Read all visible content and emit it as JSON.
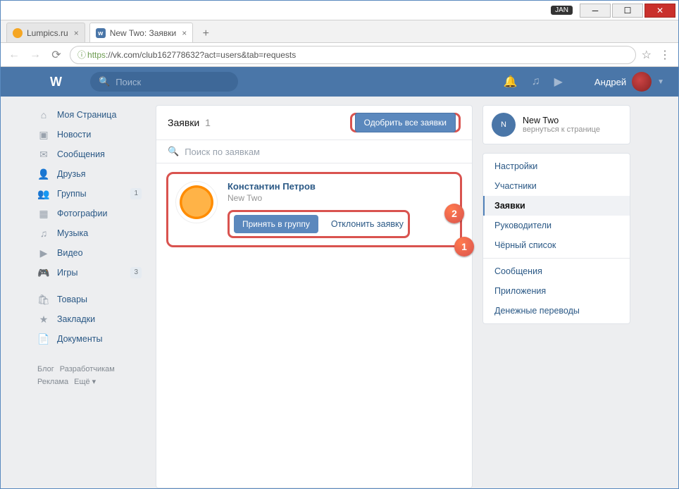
{
  "browser": {
    "ext_label": "JAN",
    "tabs": [
      {
        "title": "Lumpics.ru",
        "favicon": "lumpics"
      },
      {
        "title": "New Two: Заявки",
        "favicon": "vk"
      }
    ],
    "url_proto": "https",
    "url_rest": "://vk.com/club162778632?act=users&tab=requests"
  },
  "vk_header": {
    "search_placeholder": "Поиск",
    "username": "Андрей"
  },
  "sidebar": {
    "items": [
      {
        "icon": "⌂",
        "label": "Моя Страница",
        "badge": ""
      },
      {
        "icon": "▣",
        "label": "Новости",
        "badge": ""
      },
      {
        "icon": "✉",
        "label": "Сообщения",
        "badge": ""
      },
      {
        "icon": "👤",
        "label": "Друзья",
        "badge": ""
      },
      {
        "icon": "👥",
        "label": "Группы",
        "badge": "1"
      },
      {
        "icon": "▦",
        "label": "Фотографии",
        "badge": ""
      },
      {
        "icon": "♫",
        "label": "Музыка",
        "badge": ""
      },
      {
        "icon": "▶",
        "label": "Видео",
        "badge": ""
      },
      {
        "icon": "🎮",
        "label": "Игры",
        "badge": "3"
      }
    ],
    "items2": [
      {
        "icon": "🛍",
        "label": "Товары"
      },
      {
        "icon": "★",
        "label": "Закладки"
      },
      {
        "icon": "📄",
        "label": "Документы"
      }
    ],
    "footer": {
      "blog": "Блог",
      "dev": "Разработчикам",
      "ads": "Реклама",
      "more": "Ещё ▾"
    }
  },
  "card": {
    "title": "Заявки",
    "count": "1",
    "approve_all": "Одобрить все заявки",
    "search_placeholder": "Поиск по заявкам",
    "request": {
      "name": "Константин Петров",
      "group": "New Two",
      "accept": "Принять в группу",
      "decline": "Отклонить заявку"
    }
  },
  "right": {
    "group_name": "New Two",
    "back": "вернуться к странице",
    "menu1": [
      {
        "label": "Настройки",
        "active": false
      },
      {
        "label": "Участники",
        "active": false
      },
      {
        "label": "Заявки",
        "active": true
      },
      {
        "label": "Руководители",
        "active": false
      },
      {
        "label": "Чёрный список",
        "active": false
      }
    ],
    "menu2": [
      {
        "label": "Сообщения"
      },
      {
        "label": "Приложения"
      },
      {
        "label": "Денежные переводы"
      }
    ]
  },
  "annotations": {
    "a1": "1",
    "a2": "2"
  }
}
